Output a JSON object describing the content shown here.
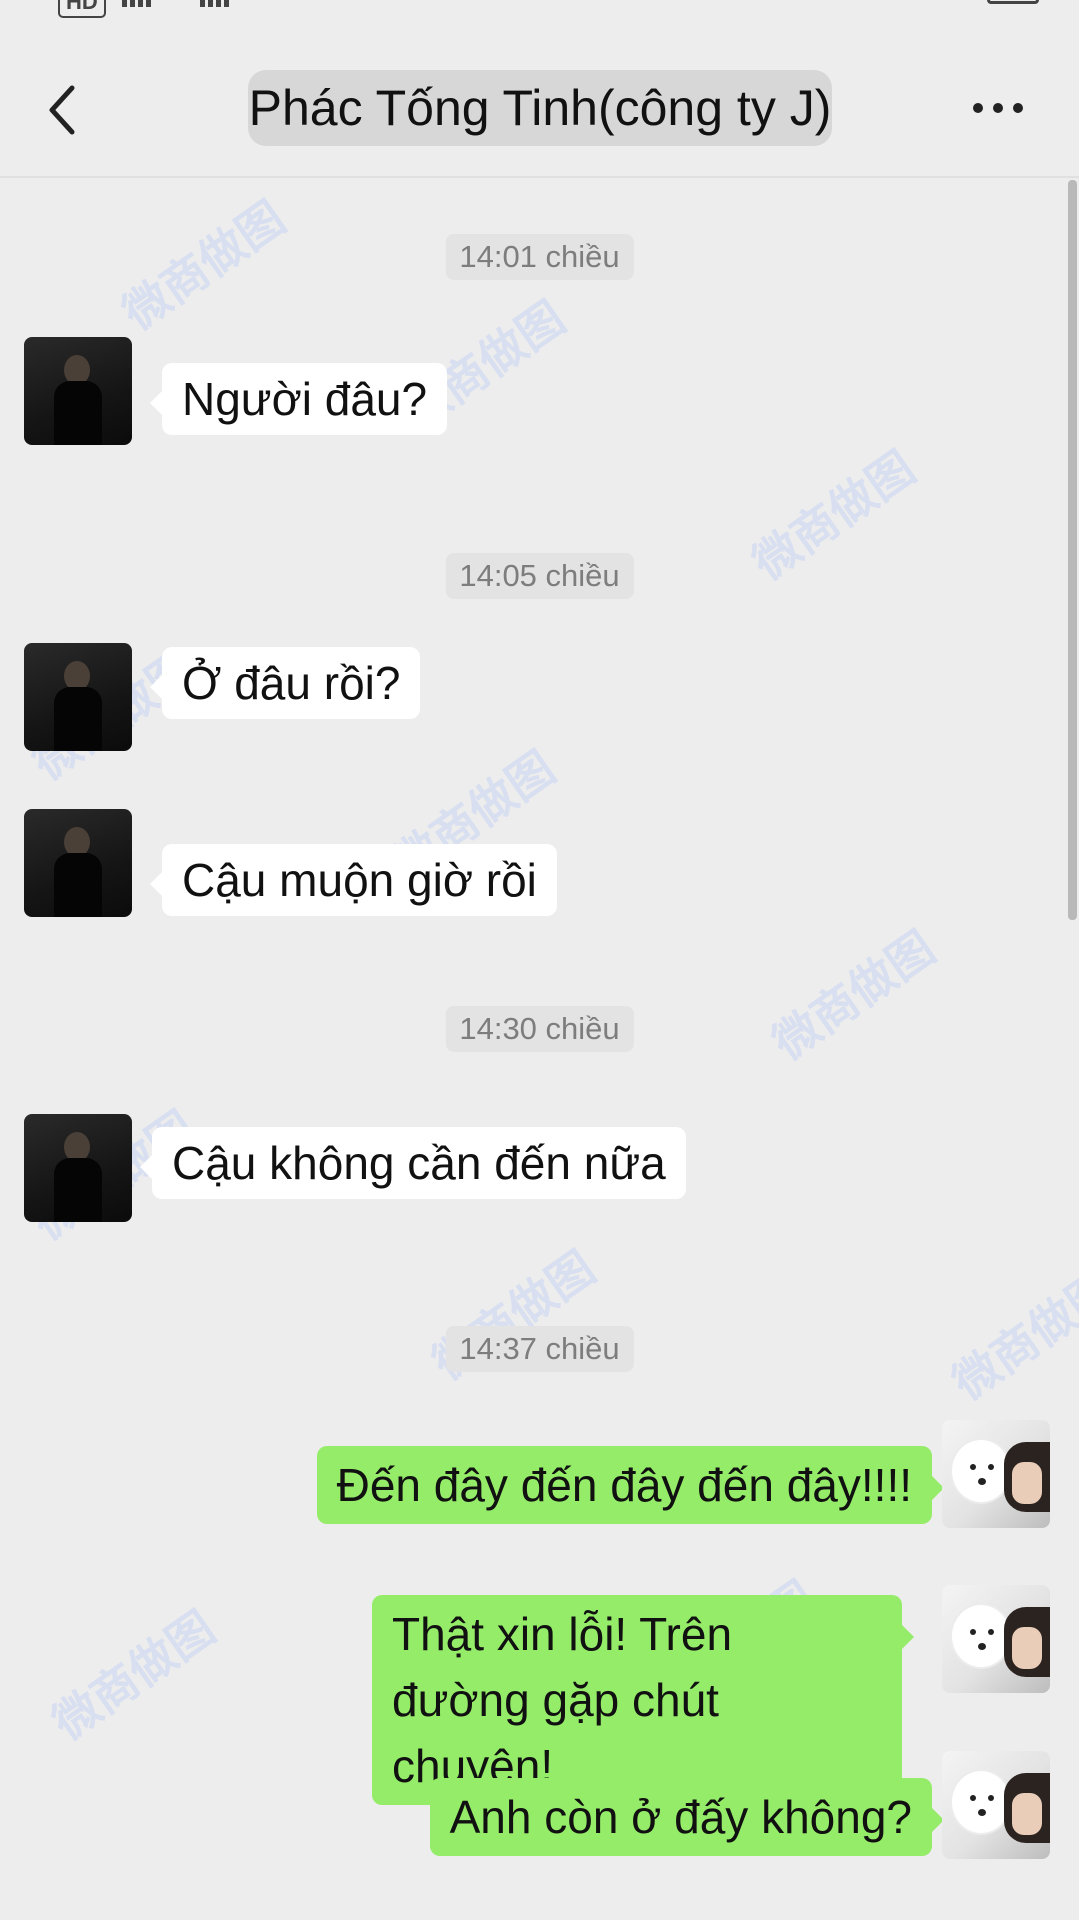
{
  "status_bar": {
    "hd_label": "HD"
  },
  "header": {
    "title": "Phác Tống Tinh(công ty J)",
    "back_icon": "chevron-left-icon",
    "more_icon": "more-dots-icon"
  },
  "watermark_text": "微商做图",
  "messages": [
    {
      "type": "time",
      "text": "14:01 chiều"
    },
    {
      "type": "received",
      "text": "Người đâu?"
    },
    {
      "type": "time",
      "text": "14:05 chiều"
    },
    {
      "type": "received",
      "text": "Ở đâu rồi?"
    },
    {
      "type": "received",
      "text": "Cậu muộn giờ rồi"
    },
    {
      "type": "time",
      "text": "14:30 chiều"
    },
    {
      "type": "received",
      "text": "Cậu không cần đến nữa"
    },
    {
      "type": "time",
      "text": "14:37 chiều"
    },
    {
      "type": "sent",
      "text": "Đến đây đến đây đến đây!!!!"
    },
    {
      "type": "sent",
      "text": "Thật xin lỗi! Trên đường gặp chút chuyện!"
    },
    {
      "type": "sent",
      "text": "Anh còn ở đấy không?"
    }
  ],
  "colors": {
    "sent_bubble": "#95ec69",
    "received_bubble": "#ffffff",
    "background": "#ededed"
  }
}
